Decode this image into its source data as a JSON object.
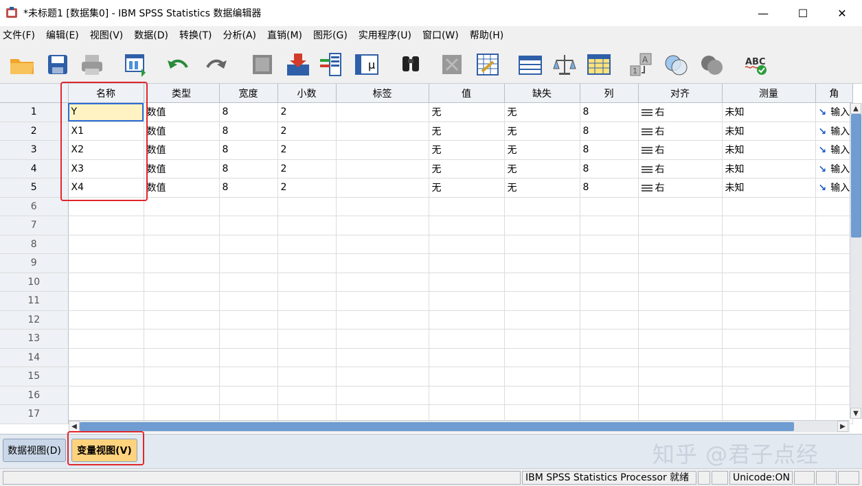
{
  "window": {
    "title": "*未标题1 [数据集0] - IBM SPSS Statistics 数据编辑器",
    "min": "—",
    "max": "☐",
    "close": "✕"
  },
  "menu": [
    "文件(F)",
    "编辑(E)",
    "视图(V)",
    "数据(D)",
    "转换(T)",
    "分析(A)",
    "直销(M)",
    "图形(G)",
    "实用程序(U)",
    "窗口(W)",
    "帮助(H)"
  ],
  "toolbar_icons": [
    "open-folder-icon",
    "save-icon",
    "print-icon",
    "dialog-recall-icon",
    "undo-icon",
    "redo-icon",
    "goto-case-icon",
    "goto-variable-icon",
    "insert-cases-icon",
    "variables-icon",
    "find-icon",
    "insert-variable-icon",
    "split-file-icon",
    "weight-cases-icon",
    "select-cases-icon",
    "value-labels-icon",
    "use-sets-icon",
    "show-all-icon",
    "spell-check-icon"
  ],
  "grid": {
    "columns": [
      "名称",
      "类型",
      "宽度",
      "小数",
      "标签",
      "值",
      "缺失",
      "列",
      "对齐",
      "测量",
      "角"
    ],
    "rows": [
      {
        "num": "1",
        "cells": [
          "Y",
          "数值",
          "8",
          "2",
          "",
          "无",
          "无",
          "8",
          "右",
          "未知",
          "输入"
        ]
      },
      {
        "num": "2",
        "cells": [
          "X1",
          "数值",
          "8",
          "2",
          "",
          "无",
          "无",
          "8",
          "右",
          "未知",
          "输入"
        ]
      },
      {
        "num": "3",
        "cells": [
          "X2",
          "数值",
          "8",
          "2",
          "",
          "无",
          "无",
          "8",
          "右",
          "未知",
          "输入"
        ]
      },
      {
        "num": "4",
        "cells": [
          "X3",
          "数值",
          "8",
          "2",
          "",
          "无",
          "无",
          "8",
          "右",
          "未知",
          "输入"
        ]
      },
      {
        "num": "5",
        "cells": [
          "X4",
          "数值",
          "8",
          "2",
          "",
          "无",
          "无",
          "8",
          "右",
          "未知",
          "输入"
        ]
      }
    ],
    "empty_rows": [
      "6",
      "7",
      "8",
      "9",
      "10",
      "11",
      "12",
      "13",
      "14",
      "15",
      "16",
      "17"
    ]
  },
  "tabs": {
    "data_view": "数据视图(D)",
    "variable_view": "变量视图(V)"
  },
  "watermark": "知乎 @君子点经",
  "status": {
    "processor": "IBM SPSS Statistics Processor 就绪",
    "unicode": "Unicode:ON"
  }
}
